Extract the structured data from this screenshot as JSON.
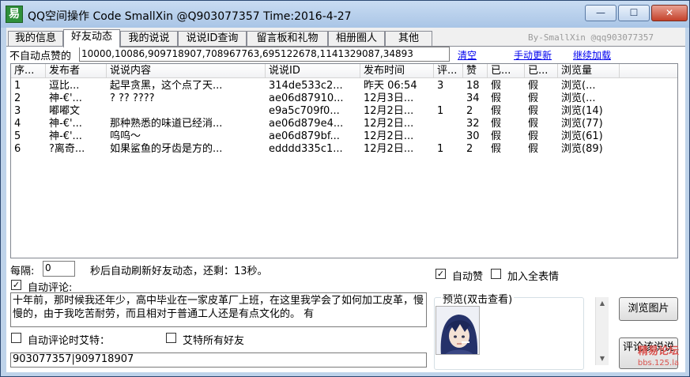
{
  "window": {
    "title": "QQ空间操作  Code SmallXin @Q903077357 Time:2016-4-27",
    "icon_glyph": "易",
    "minimize": "—",
    "maximize": "☐",
    "close": "✕"
  },
  "tabs": [
    "我的信息",
    "好友动态",
    "我的说说",
    "说说ID查询",
    "留言板和礼物",
    "相册圈人",
    "其他"
  ],
  "active_tab": "好友动态",
  "byline": "By-SmallXin @qq903077357",
  "filter": {
    "label": "不自动点赞的",
    "value": "10000,10086,909718907,708967763,695122678,1141329087,34893",
    "clear": "清空",
    "manual_refresh": "手动更新",
    "load_more": "继续加载"
  },
  "feed": {
    "columns": [
      "序...",
      "发布者",
      "说说内容",
      "说说ID",
      "发布时间",
      "评...",
      "赞",
      "已...",
      "已...",
      "浏览量"
    ],
    "rows": [
      [
        "1",
        "逗比...",
        "起早贪黑，这个点了天...",
        "314de533c2...",
        "昨天 06:54",
        "3",
        "18",
        "假",
        "假",
        "浏览(..."
      ],
      [
        "2",
        "神-€'...",
        "? ?? ????",
        "ae06d87910...",
        "12月3日...",
        "",
        "34",
        "假",
        "假",
        "浏览(..."
      ],
      [
        "3",
        "嘟嘟文",
        "",
        "e9a5c709f0...",
        "12月2日...",
        "1",
        "2",
        "假",
        "假",
        "浏览(14)"
      ],
      [
        "4",
        "神-€'...",
        "那种熟悉的味道已经消...",
        "ae06d879e4...",
        "12月2日...",
        "",
        "32",
        "假",
        "假",
        "浏览(77)"
      ],
      [
        "5",
        "神-€'...",
        "呜呜～",
        "ae06d879bf...",
        "12月2日...",
        "",
        "30",
        "假",
        "假",
        "浏览(61)"
      ],
      [
        "6",
        "?离奇...",
        "如果鲨鱼的牙齿是方的...",
        "edddd335c1...",
        "12月2日...",
        "1",
        "2",
        "假",
        "假",
        "浏览(89)"
      ]
    ]
  },
  "refresh": {
    "label": "每隔:",
    "value": "0",
    "status": "秒后自动刷新好友动态，还剩：13秒。"
  },
  "auto_like": {
    "label": "自动赞",
    "checked": true
  },
  "add_all_emoji": {
    "label": "加入全表情",
    "checked": false
  },
  "auto_comment": {
    "label": "自动评论:",
    "checked": true
  },
  "comment_text": "十年前，那时候我还年少，高中毕业在一家皮革厂上班，在这里我学会了如何加工皮革，慢慢的，由于我吃苦耐劳，而且相对于普通工人还是有点文化的。 有",
  "mention_on_comment": {
    "label": "自动评论时艾特：",
    "checked": false
  },
  "mention_all": {
    "label": "艾特所有好友",
    "checked": false
  },
  "mention_ids": "903077357|909718907",
  "preview": {
    "title": "预览(双击查看)"
  },
  "buttons": {
    "browse_images": "浏览图片",
    "comment_this": "评论该说说"
  },
  "watermark": {
    "line1": "精易论坛",
    "line2": "bbs.125.la"
  },
  "colors": {
    "title_bg": "#bed3ea",
    "link": "#0000ee",
    "close": "#c4412a",
    "watermark": "#d9534f"
  }
}
